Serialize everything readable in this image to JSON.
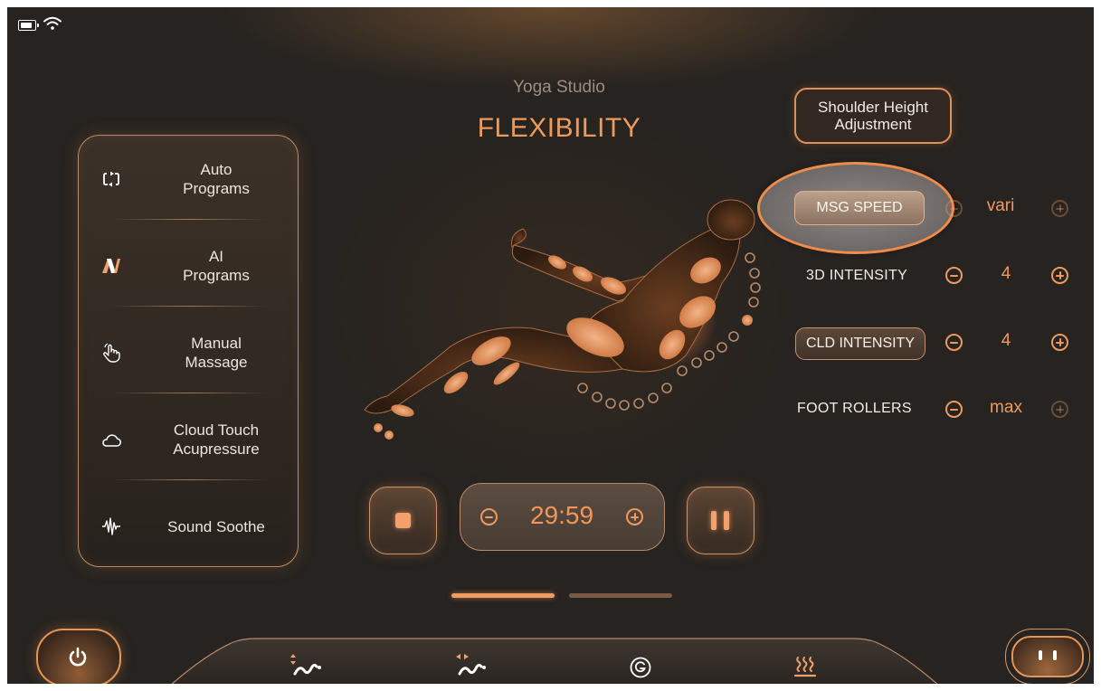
{
  "status_bar": {
    "battery_level": 0.85,
    "wifi_icon": "wifi-icon"
  },
  "header": {
    "studio": "Yoga Studio",
    "program": "FLEXIBILITY"
  },
  "sidebar": {
    "items": [
      {
        "label_line1": "Auto",
        "label_line2": "Programs",
        "icon": "auto-cycle-icon"
      },
      {
        "label_line1": "AI",
        "label_line2": "Programs",
        "icon": "ai-logo-icon"
      },
      {
        "label_line1": "Manual",
        "label_line2": "Massage",
        "icon": "hand-tap-icon"
      },
      {
        "label_line1": "Cloud Touch",
        "label_line2": "Acupressure",
        "icon": "cloud-icon"
      },
      {
        "label_line1": "Sound Soothe",
        "label_line2": "",
        "icon": "sound-wave-icon"
      }
    ]
  },
  "controls": {
    "shoulder": {
      "line1": "Shoulder Height",
      "line2": "Adjustment"
    },
    "rows": [
      {
        "label": "MSG SPEED",
        "value": "vari"
      },
      {
        "label": "3D INTENSITY",
        "value": "4"
      },
      {
        "label": "CLD INTENSITY",
        "value": "4"
      },
      {
        "label": "FOOT ROLLERS",
        "value": "max"
      }
    ]
  },
  "playback": {
    "time": "29:59"
  },
  "pager": {
    "active_page": 1,
    "page_count": 2
  },
  "bottom_nav": {
    "items": [
      "up-down-wave-icon",
      "left-right-wave-icon",
      "g-circle-icon",
      "heat-icon"
    ]
  },
  "colors": {
    "accent": "#EE9A5F",
    "background": "#262320",
    "highlight_ring": "#F08C4A"
  }
}
